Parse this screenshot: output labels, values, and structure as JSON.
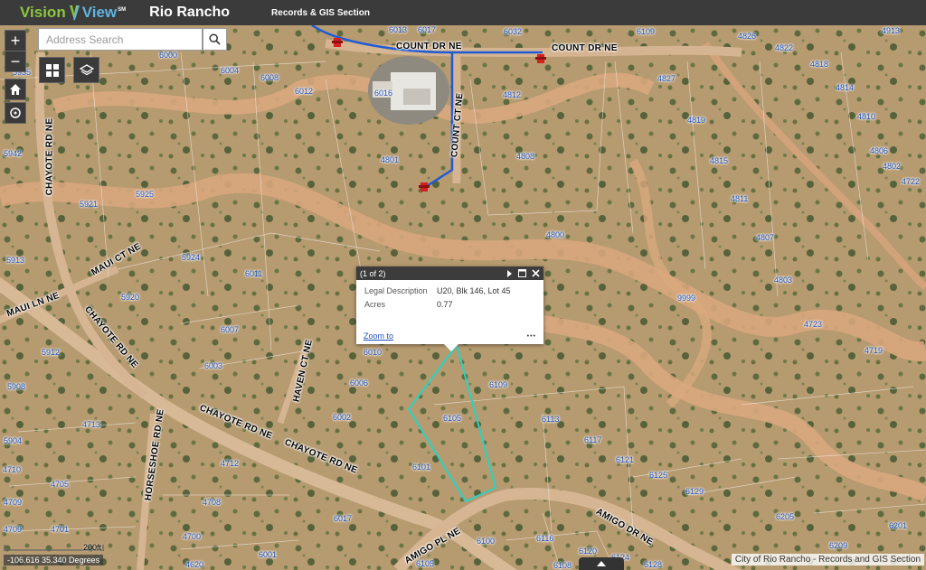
{
  "header": {
    "logo_part1": "Vision",
    "logo_part2": "View",
    "logo_tm": "SM",
    "city": "Rio Rancho",
    "section": "Records & GIS Section"
  },
  "search": {
    "placeholder": "Address Search"
  },
  "controls": {
    "zoom_in": "+",
    "zoom_out": "−"
  },
  "popup": {
    "counter": "(1 of 2)",
    "rows": [
      {
        "key": "Legal Description",
        "value": "U20, Blk 146, Lot 45"
      },
      {
        "key": "Acres",
        "value": "0.77"
      }
    ],
    "zoom_link": "Zoom to",
    "more": "•••"
  },
  "roads": {
    "count_dr_1": "COUNT DR NE",
    "count_dr_2": "COUNT DR NE",
    "count_ct": "COUNT CT NE",
    "chayote_1": "CHAYOTE RD NE",
    "chayote_2": "CHAYOTE RD NE",
    "chayote_3": "CHAYOTE RD NE",
    "chayote_4": "CHAYOTE RD NE",
    "maui_ct": "MAUI CT NE",
    "maui_ln": "MAUI LN NE",
    "haven_ct": "HAVEN CT NE",
    "horseshoe": "HORSESHOE RD NE",
    "amigo_dr": "AMIGO DR NE",
    "amigo_pl": "AMIGO PL NE"
  },
  "parcels": {
    "p6013": "6013",
    "p6017": "6017",
    "p6032": "6032",
    "p6109a": "6109",
    "p4826": "4826",
    "p4822": "4822",
    "p4913": "4913",
    "p6000": "6000",
    "p6004": "6004",
    "p6008": "6008",
    "p6012": "6012",
    "p5935": "5935",
    "p6016": "6016",
    "p4812": "4812",
    "p4827": "4827",
    "p4818": "4818",
    "p4814": "4814",
    "p4810": "4810",
    "p4819": "4819",
    "p4806": "4806",
    "p4801": "4801",
    "p4808": "4808",
    "p4815": "4815",
    "p4802": "4802",
    "p5942": "5942",
    "p5925": "5925",
    "p5921": "5921",
    "p4811": "4811",
    "p4722": "4722",
    "p4800": "4800",
    "p4807": "4807",
    "p5913": "5913",
    "p5924": "5924",
    "p6011": "6011",
    "p4803": "4803",
    "p5920": "5920",
    "p9999": "9999",
    "p4723": "4723",
    "p6007": "6007",
    "p5912": "5912",
    "p6010": "6010",
    "p4719": "4719",
    "p6003": "6003",
    "p6006": "6006",
    "p6109b": "6109",
    "p5908": "5908",
    "p6105": "6105",
    "p6113": "6113",
    "p6002": "6002",
    "p4713": "4713",
    "p6117": "6117",
    "p5904": "5904",
    "p4712": "4712",
    "p6101": "6101",
    "p6121": "6121",
    "p4710": "4710",
    "p6125": "6125",
    "p4705": "4705",
    "p6129": "6129",
    "p4708": "4708",
    "p4709": "4709",
    "p6017b": "6017",
    "p6205": "6205",
    "p6201": "6201",
    "p4701": "4701",
    "p4700": "4700",
    "p6100": "6100",
    "p6116": "6116",
    "p6209": "6209",
    "p6001": "6001",
    "p6120": "6120",
    "p4620": "4620",
    "p6124": "6124",
    "p6128": "6128",
    "p6105b": "6105",
    "p6108": "6108"
  },
  "scale_label": "200ft",
  "coords": "-106.616 35.340 Degrees",
  "attribution": "City of Rio Rancho - Records and GIS Section",
  "colors": {
    "header_bg": "#3b3b3b",
    "logo_green": "#8cc63f",
    "logo_blue": "#5fb4e0",
    "parcel_label": "#1d4fb8",
    "selected_parcel": "#27d3c3",
    "water_line": "#1e5bd6"
  }
}
